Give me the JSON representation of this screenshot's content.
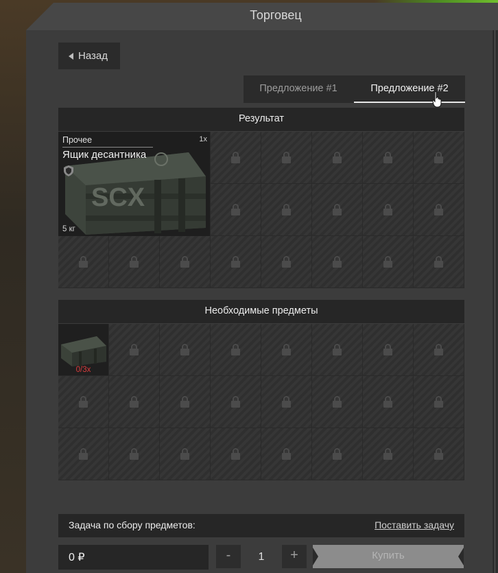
{
  "window": {
    "title": "Торговец"
  },
  "nav": {
    "back_label": "Назад"
  },
  "tabs": [
    {
      "label": "Предложение #1",
      "active": false
    },
    {
      "label": "Предложение #2",
      "active": true
    }
  ],
  "result": {
    "header": "Результат",
    "item": {
      "category": "Прочее",
      "name": "Ящик десантника",
      "quantity": "1x",
      "weight": "5 кг",
      "icon": "crate-image",
      "badge_icon": "shield-icon"
    },
    "locked_slots": 22
  },
  "required": {
    "header": "Необходимые предметы",
    "item": {
      "count": "0/3x",
      "icon": "small-crate-image",
      "count_color": "#d93c3c"
    },
    "locked_slots": 23
  },
  "task": {
    "label": "Задача по сбору предметов:",
    "link": "Поставить задачу"
  },
  "purchase": {
    "price": "0 ₽",
    "minus": "-",
    "quantity": "1",
    "plus": "+",
    "buy_label": "Купить"
  },
  "colors": {
    "accent_green": "#6fbf2d",
    "panel": "#3c3c3c",
    "alert_red": "#d93c3c"
  }
}
